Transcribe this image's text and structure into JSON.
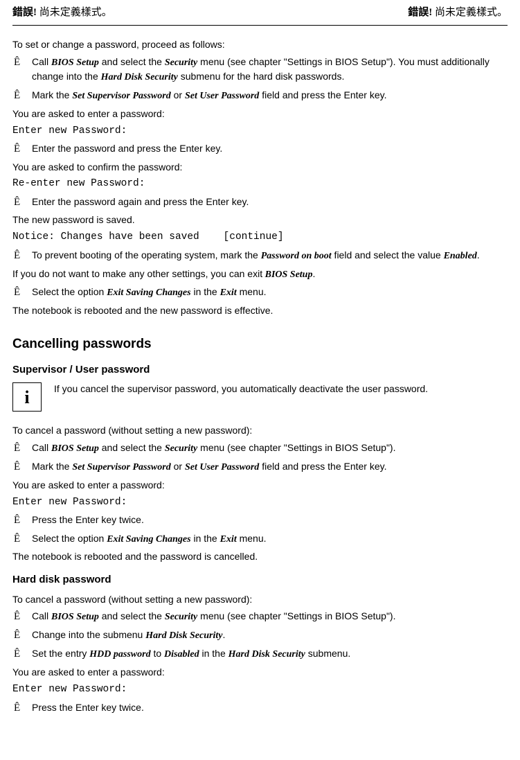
{
  "header": {
    "left_err": "錯誤!",
    "left_rest": " 尚未定義樣式。",
    "right_err": "錯誤!",
    "right_rest": " 尚未定義樣式。"
  },
  "intro": "To set or change a password, proceed as follows:",
  "marker": "Ê",
  "step1": {
    "a": "Call ",
    "b": "BIOS Setup",
    "c": " and select the ",
    "d": "Security",
    "e": " menu (see chapter \"Settings in BIOS Setup\"). You must additionally change into the ",
    "f": "Hard Disk Security",
    "g": " submenu for the hard disk passwords."
  },
  "step2": {
    "a": "Mark the ",
    "b": "Set Supervisor Password",
    "c": " or ",
    "d": "Set User Password",
    "e": " field and press the Enter key."
  },
  "asked_enter": "You are asked to enter a password:",
  "mono_enter": "Enter new Password:",
  "step3": "Enter the password and press the Enter key.",
  "asked_confirm": "You are asked to confirm the password:",
  "mono_reenter": "Re-enter new Password:",
  "step4": "Enter the password again and press the Enter key.",
  "new_saved": "The new password is saved.",
  "mono_notice": "Notice: Changes have been saved    [continue]",
  "step5": {
    "a": "To prevent booting of the operating system, mark the ",
    "b": "Password on boot",
    "c": " field and select the value ",
    "d": "Enabled",
    "e": "."
  },
  "if_not": {
    "a": "If you do not want to make any other settings, you can exit",
    "b": " BIOS Setup",
    "c": "."
  },
  "step6": {
    "a": "Select the option ",
    "b": "Exit Saving Changes",
    "c": " in the ",
    "d": "Exit",
    "e": " menu."
  },
  "reboot_effective": "The notebook is rebooted and the new password is effective.",
  "h2_cancel": "Cancelling passwords",
  "sub_sup_user": "Supervisor / User password",
  "info_glyph": "i",
  "info_text": "If you cancel the supervisor password, you automatically deactivate the user password.",
  "to_cancel": "To cancel a password (without setting a new password):",
  "c_step1": {
    "a": "Call ",
    "b": "BIOS Setup",
    "c": " and select the ",
    "d": "Security",
    "e": " menu (see chapter \"Settings in BIOS Setup\")."
  },
  "c_step2": {
    "a": "Mark the ",
    "b": "Set Supervisor Password",
    "c": " or ",
    "d": "Set User Password",
    "e": " field and press the Enter key."
  },
  "c_step3": "Press the Enter key twice.",
  "c_step4": {
    "a": "Select the option ",
    "b": "Exit Saving Changes",
    "c": " in the ",
    "d": "Exit",
    "e": " menu."
  },
  "reboot_cancel": "The notebook is rebooted and the password is cancelled.",
  "sub_hdd": "Hard disk password",
  "h_step1": {
    "a": "Call ",
    "b": "BIOS Setup",
    "c": " and select the ",
    "d": "Security",
    "e": " menu (see chapter \"Settings in BIOS Setup\")."
  },
  "h_step2": {
    "a": "Change into the submenu ",
    "b": "Hard Disk Security",
    "c": "."
  },
  "h_step3": {
    "a": "Set the entry ",
    "b": "HDD password",
    "c": " to ",
    "d": "Disabled",
    "e": " in the ",
    "f": "Hard Disk Security",
    "g": " submenu."
  },
  "h_step4": "Press the Enter key twice."
}
